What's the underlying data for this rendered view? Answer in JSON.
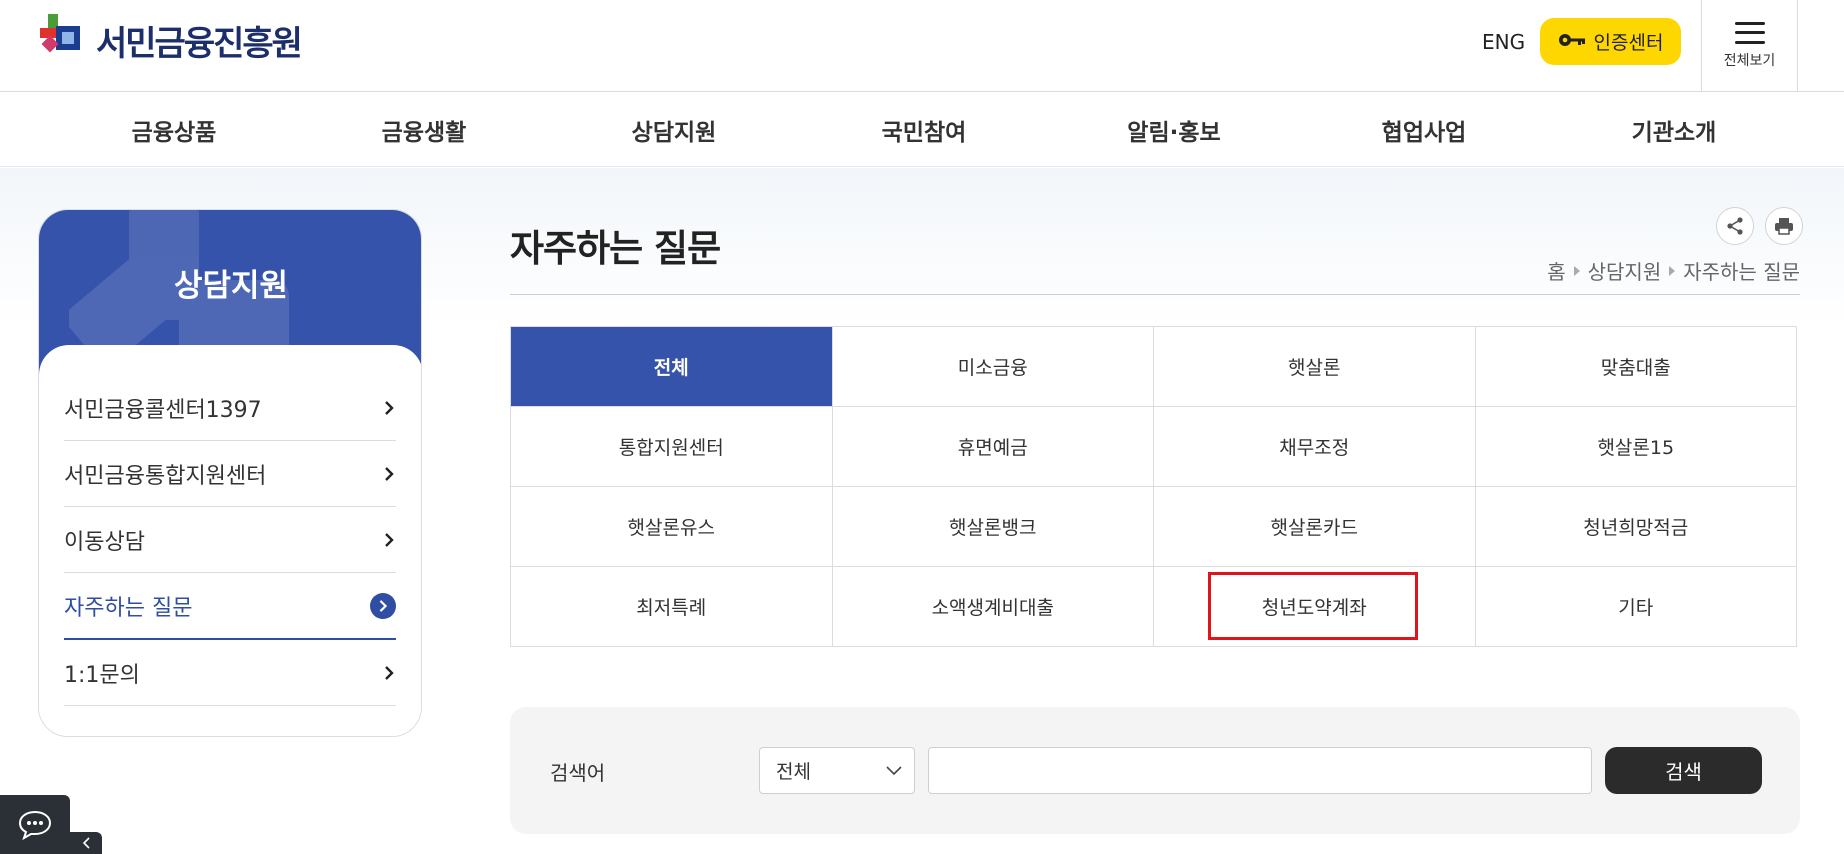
{
  "header": {
    "logo_text": "서민금융진흥원",
    "lang_label": "ENG",
    "auth_label": "인증센터",
    "all_menu_label": "전체보기"
  },
  "gnb": {
    "items": [
      {
        "label": "금융상품"
      },
      {
        "label": "금융생활"
      },
      {
        "label": "상담지원"
      },
      {
        "label": "국민참여"
      },
      {
        "label": "알림·홍보"
      },
      {
        "label": "협업사업"
      },
      {
        "label": "기관소개"
      }
    ]
  },
  "lnb": {
    "title": "상담지원",
    "items": [
      {
        "label": "서민금융콜센터1397",
        "active": false
      },
      {
        "label": "서민금융통합지원센터",
        "active": false
      },
      {
        "label": "이동상담",
        "active": false
      },
      {
        "label": "자주하는 질문",
        "active": true
      },
      {
        "label": "1:1문의",
        "active": false
      }
    ]
  },
  "main": {
    "title": "자주하는 질문",
    "breadcrumb": [
      "홈",
      "상담지원",
      "자주하는 질문"
    ],
    "categories": [
      {
        "label": "전체",
        "active": true
      },
      {
        "label": "미소금융",
        "active": false
      },
      {
        "label": "햇살론",
        "active": false
      },
      {
        "label": "맞춤대출",
        "active": false
      },
      {
        "label": "통합지원센터",
        "active": false
      },
      {
        "label": "휴면예금",
        "active": false
      },
      {
        "label": "채무조정",
        "active": false
      },
      {
        "label": "햇살론15",
        "active": false
      },
      {
        "label": "햇살론유스",
        "active": false
      },
      {
        "label": "햇살론뱅크",
        "active": false
      },
      {
        "label": "햇살론카드",
        "active": false
      },
      {
        "label": "청년희망적금",
        "active": false
      },
      {
        "label": "최저특례",
        "active": false
      },
      {
        "label": "소액생계비대출",
        "active": false
      },
      {
        "label": "청년도약계좌",
        "active": false,
        "highlighted": true
      },
      {
        "label": "기타",
        "active": false
      }
    ]
  },
  "search": {
    "label": "검색어",
    "select_value": "전체",
    "input_value": "",
    "button_label": "검색"
  },
  "colors": {
    "primary": "#3553ab",
    "accent_yellow": "#ffd700",
    "highlight_red": "#e0151c",
    "dark_button": "#2b2b2b"
  },
  "icons": {
    "auth": "key-icon",
    "all_menu": "hamburger-icon",
    "share": "share-icon",
    "print": "print-icon",
    "chat": "chat-icon"
  }
}
